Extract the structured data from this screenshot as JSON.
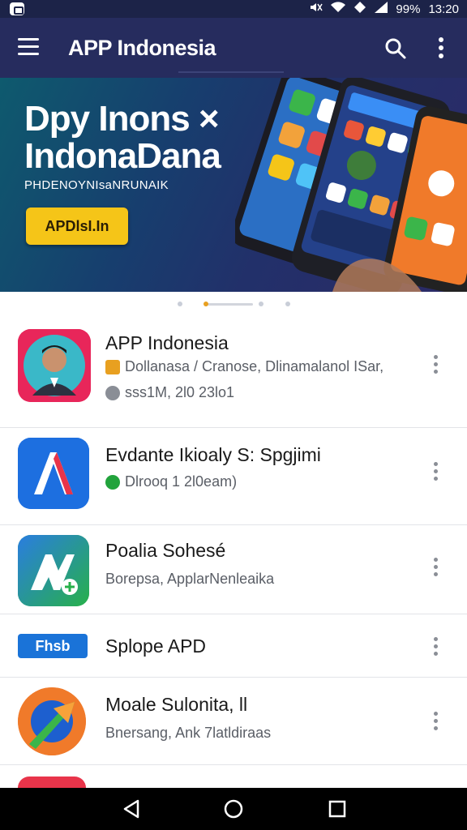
{
  "status_bar": {
    "battery": "99%",
    "time": "13:20"
  },
  "app_bar": {
    "title": "APP Indonesia"
  },
  "banner": {
    "title_line1": "Dpy Inons ×",
    "title_line2": "IndonaDana",
    "subtitle": "PHDENOYNIsaNRUNAIK",
    "button_label": "APDlsI.In"
  },
  "carousel": {
    "page_count": 4,
    "active_index": 1
  },
  "apps": [
    {
      "name": "APP Indonesia",
      "meta1": "Dollanasa / Cranose, Dlinamalanol ISar,",
      "meta2": "sss1M, 2l0 23lo1",
      "icon": "person-photo-icon"
    },
    {
      "name": "Evdante Ikioaly S: Spgjimi",
      "meta1": "Dlrooq 1 2l0eam)",
      "icon": "a-logo-icon"
    },
    {
      "name": "Poalia Sohesé",
      "meta1": "Borepsa, ApplarNenleaika",
      "icon": "av-logo-icon"
    },
    {
      "name": "Splope APD",
      "icon_text": "Fhsb",
      "icon": "rectangle-logo-icon"
    },
    {
      "name": "Moale Sulonita, ll",
      "meta1": "Bnersang, Ank 7latldiraas",
      "icon": "arrow-logo-icon"
    }
  ],
  "colors": {
    "app_bar": "#262c5e",
    "accent": "#f5c518",
    "verified": "#22a33c"
  }
}
